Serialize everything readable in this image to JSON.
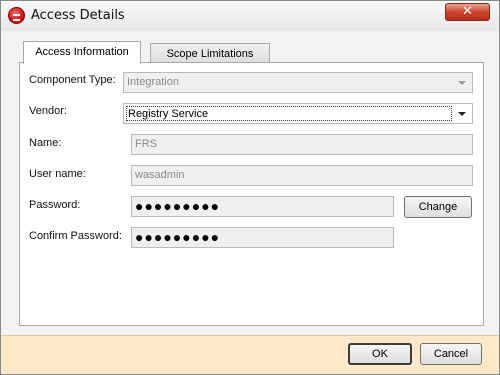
{
  "window": {
    "title": "Access Details",
    "close_label": "✕"
  },
  "tabs": [
    {
      "label": "Access Information"
    },
    {
      "label": "Scope Limitations"
    }
  ],
  "form": {
    "component_type": {
      "label": "Component Type:",
      "value": "Integration"
    },
    "vendor": {
      "label": "Vendor:",
      "value": "Registry Service"
    },
    "name": {
      "label": "Name:",
      "value": "FRS"
    },
    "user_name": {
      "label": "User name:",
      "value": "wasadmin"
    },
    "password": {
      "label": "Password:",
      "value": "●●●●●●●●●"
    },
    "confirm_password": {
      "label": "Confirm Password:",
      "value": "●●●●●●●●●"
    },
    "change_label": "Change"
  },
  "footer": {
    "ok_label": "OK",
    "cancel_label": "Cancel"
  },
  "colors": {
    "footer_bg": "#fde9c9",
    "close_button": "#c9412a"
  }
}
